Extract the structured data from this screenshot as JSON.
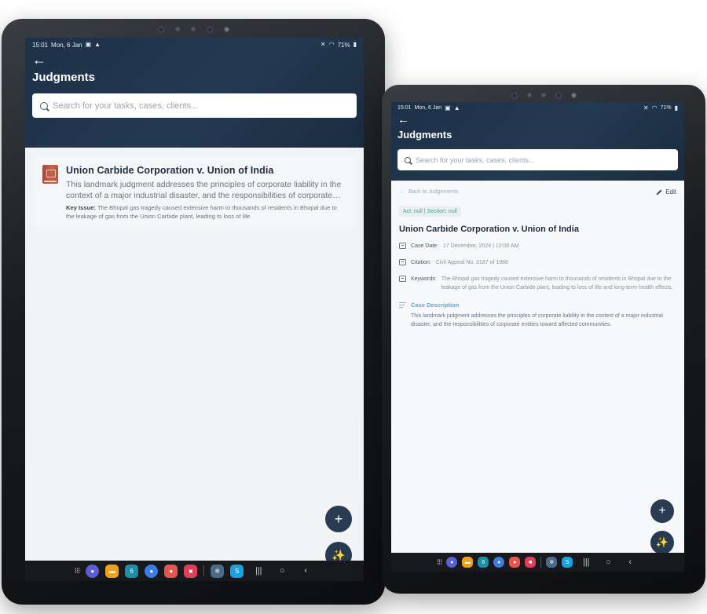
{
  "status": {
    "time": "15:01",
    "date": "Mon, 6 Jan",
    "battery": "71%"
  },
  "header": {
    "title": "Judgments"
  },
  "search": {
    "placeholder": "Search for your tasks, cases, clients..."
  },
  "list": {
    "items": [
      {
        "title": "Union Carbide Corporation v. Union of India",
        "description": "This landmark judgment addresses the principles of corporate liability in the context of a major industrial disaster, and the responsibilities of corporate entities toward affected communities.",
        "key_issue_label": "Key Issue:",
        "key_issue": "The Bhopal gas tragedy caused extensive harm to thousands of residents in Bhopal due to the leakage of gas from the Union Carbide plant, leading to loss of life"
      }
    ]
  },
  "detail": {
    "back_label": "Back to Judgements",
    "edit_label": "Edit",
    "meta": "Act: null | Section: null",
    "title": "Union Carbide Corporation v. Union of India",
    "case_date_label": "Case Date:",
    "case_date": "17 December, 2024 | 12:00 AM",
    "citation_label": "Citation:",
    "citation": "Civil Appeal No. 3187 of 1988",
    "keywords_label": "Keywords:",
    "keywords": "The Bhopal gas tragedy caused extensive harm to thousands of residents in Bhopal due to the leakage of gas from the Union Carbide plant, leading to loss of life and long-term health effects.",
    "description_heading": "Case Description",
    "description": "This landmark judgment addresses the principles of corporate liability in the context of a major industrial disaster, and the responsibilities of corporate entities toward affected communities."
  },
  "fab": {
    "add": "+",
    "ai": "✨"
  },
  "navbar": {
    "apps": [
      {
        "name": "internet",
        "color": "#5b5fd6"
      },
      {
        "name": "files",
        "color": "#f0a11b"
      },
      {
        "name": "calendar",
        "color": "#1d8ea8"
      },
      {
        "name": "messages",
        "color": "#3b7de0"
      },
      {
        "name": "contacts",
        "color": "#e8554d"
      },
      {
        "name": "screen-recorder",
        "color": "#e03d5a"
      },
      {
        "name": "settings",
        "color": "#4a6a8a"
      },
      {
        "name": "skype",
        "color": "#1aa1e0"
      }
    ]
  },
  "colors": {
    "header": "#1d3148",
    "accent_teal": "#5a9c8a",
    "accent_blue": "#6aa3d1"
  }
}
